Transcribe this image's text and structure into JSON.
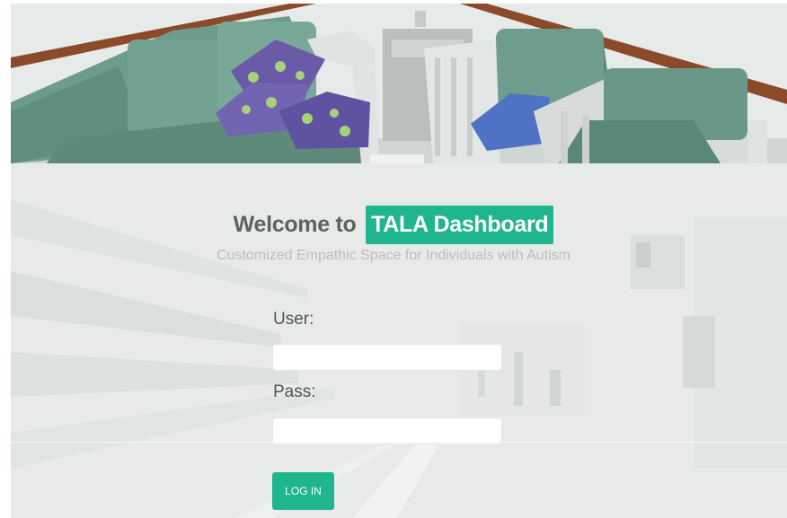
{
  "header": {
    "image": "lounge-room-photo"
  },
  "welcome": {
    "prefix": "Welcome to",
    "brand": "TALA Dashboard",
    "subtitle": "Customized Empathic Space for Individuals with Autism",
    "brand_color": "#1fb58f"
  },
  "form": {
    "user_label": "User:",
    "user_value": "",
    "pass_label": "Pass:",
    "pass_value": "",
    "login_label": "LOG IN"
  },
  "background": {
    "image": "blurred-station-photo"
  }
}
